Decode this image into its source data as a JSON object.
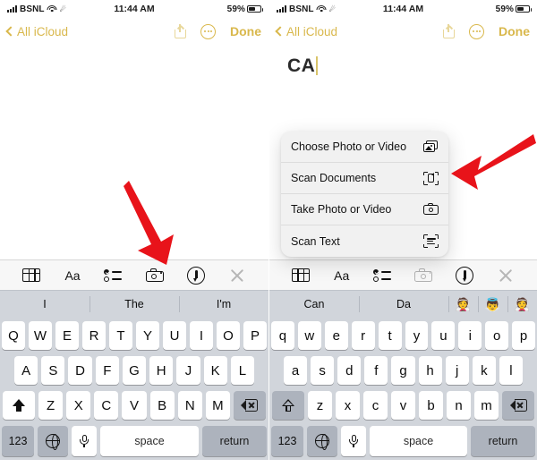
{
  "status_bar": {
    "carrier": "BSNL",
    "time": "11:44 AM",
    "battery_percent": "59%",
    "wifi_icon": "wifi-icon",
    "signal_icon": "cellular-signal-icon",
    "location_icon": "location-services-icon",
    "battery_icon": "battery-icon"
  },
  "nav_bar": {
    "back_label": "All iCloud",
    "back_icon": "chevron-left-icon",
    "share_icon": "share-icon",
    "more_icon": "more-ellipsis-icon",
    "done_label": "Done",
    "accent_color": "#d9b84c"
  },
  "note": {
    "left_title": "",
    "right_title": "CA"
  },
  "context_menu": {
    "items": [
      {
        "label": "Choose Photo or Video",
        "icon": "photos-icon"
      },
      {
        "label": "Scan Documents",
        "icon": "scan-documents-icon"
      },
      {
        "label": "Take Photo or Video",
        "icon": "camera-icon"
      },
      {
        "label": "Scan Text",
        "icon": "scan-text-icon"
      }
    ],
    "background_color": "#f1f1f1"
  },
  "keyboard_toolbar": {
    "items": [
      {
        "name": "table-icon",
        "label": ""
      },
      {
        "name": "format-aa-icon",
        "label": "Aa"
      },
      {
        "name": "checklist-icon",
        "label": ""
      },
      {
        "name": "camera-icon",
        "label": ""
      },
      {
        "name": "markup-pen-icon",
        "label": ""
      },
      {
        "name": "close-icon",
        "label": ""
      }
    ]
  },
  "suggestions": {
    "left": [
      "I",
      "The",
      "I'm"
    ],
    "right": [
      "Can",
      "Da"
    ],
    "right_emoji": [
      "👰",
      "👼",
      "👰"
    ]
  },
  "keyboard": {
    "left": {
      "row1": [
        "Q",
        "W",
        "E",
        "R",
        "T",
        "Y",
        "U",
        "I",
        "O",
        "P"
      ],
      "row2": [
        "A",
        "S",
        "D",
        "F",
        "G",
        "H",
        "J",
        "K",
        "L"
      ],
      "row3": [
        "Z",
        "X",
        "C",
        "V",
        "B",
        "N",
        "M"
      ],
      "shift_state": "active",
      "shift_icon": "shift-icon",
      "delete_icon": "delete-icon"
    },
    "right": {
      "row1": [
        "q",
        "w",
        "e",
        "r",
        "t",
        "y",
        "u",
        "i",
        "o",
        "p"
      ],
      "row2": [
        "a",
        "s",
        "d",
        "f",
        "g",
        "h",
        "j",
        "k",
        "l"
      ],
      "row3": [
        "z",
        "x",
        "c",
        "v",
        "b",
        "n",
        "m"
      ],
      "shift_state": "inactive",
      "shift_icon": "shift-icon",
      "delete_icon": "delete-icon"
    },
    "bottom": {
      "numbers_label": "123",
      "globe_icon": "globe-icon",
      "mic_icon": "microphone-icon",
      "space_label": "space",
      "return_label": "return"
    },
    "key_bg": "#ffffff",
    "keyboard_bg": "#d1d5db"
  },
  "annotations": {
    "arrow_color": "#e8131a",
    "left_arrow_target": "camera-toolbar-button",
    "right_arrow_target": "scan-documents-menu-item"
  }
}
